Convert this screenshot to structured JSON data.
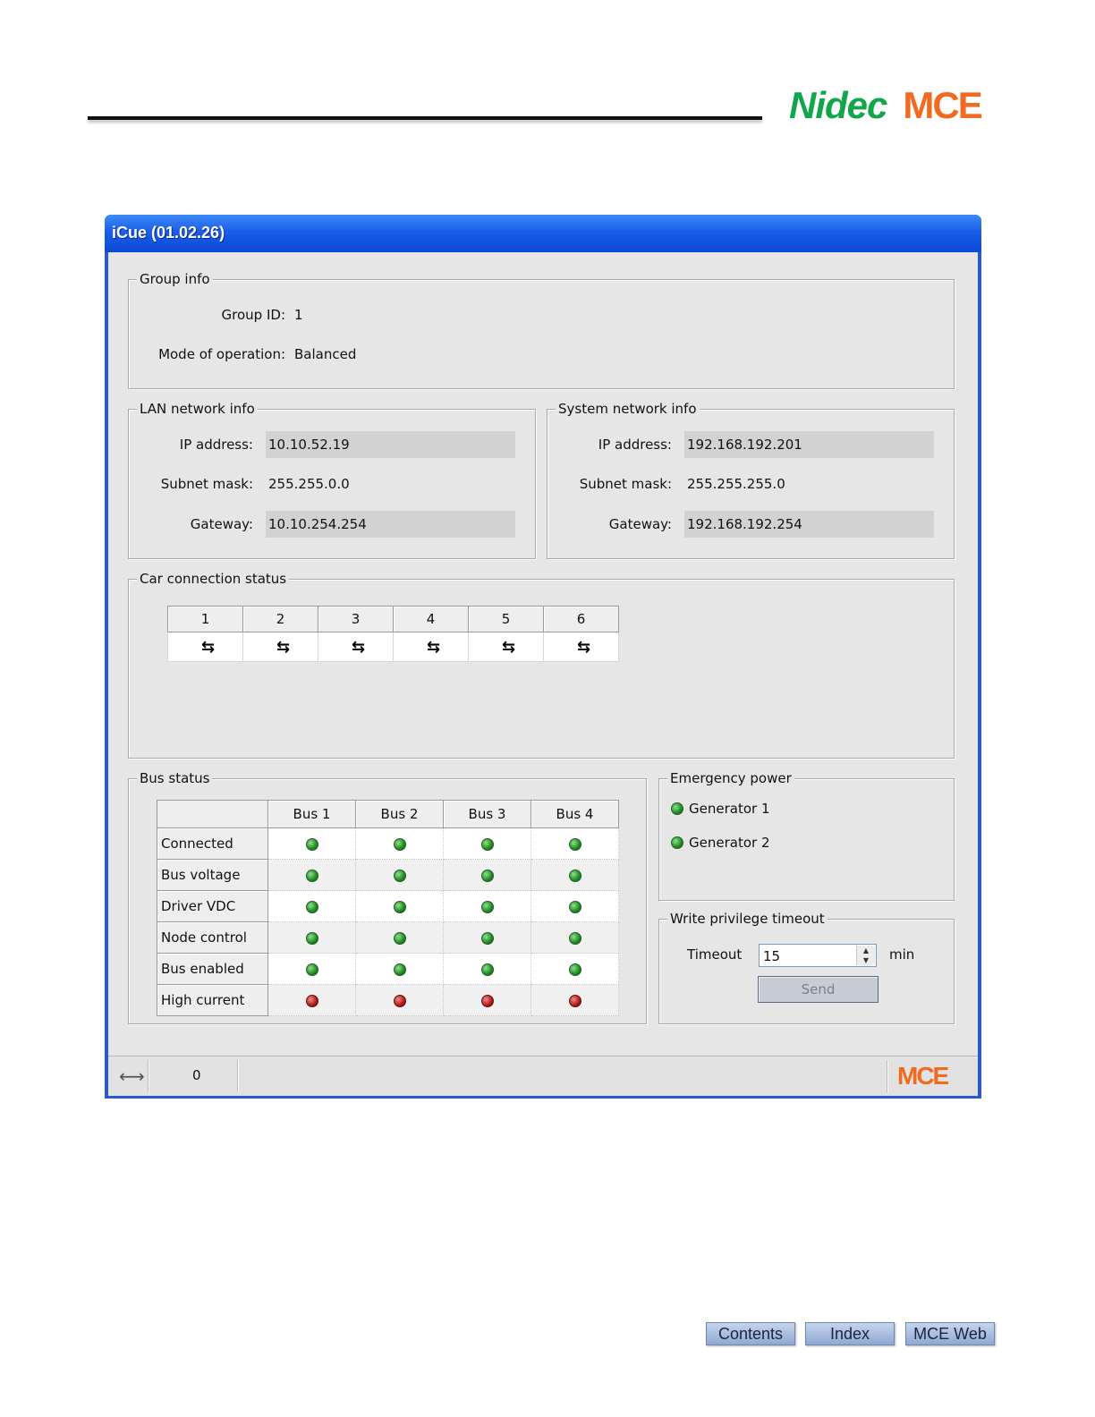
{
  "brand": {
    "company": "Nidec",
    "product": "MCE"
  },
  "window": {
    "title": "iCue (01.02.26)"
  },
  "group_info": {
    "legend": "Group info",
    "group_id_label": "Group ID:",
    "group_id": "1",
    "mode_label": "Mode of operation:",
    "mode": "Balanced"
  },
  "lan": {
    "legend": "LAN network info",
    "ip_label": "IP address:",
    "ip": "10.10.52.19",
    "subnet_label": "Subnet mask:",
    "subnet": "255.255.0.0",
    "gateway_label": "Gateway:",
    "gateway": "10.10.254.254"
  },
  "system": {
    "legend": "System network info",
    "ip_label": "IP address:",
    "ip": "192.168.192.201",
    "subnet_label": "Subnet mask:",
    "subnet": "255.255.255.0",
    "gateway_label": "Gateway:",
    "gateway": "192.168.192.254"
  },
  "cars": {
    "legend": "Car connection status",
    "ids": [
      "1",
      "2",
      "3",
      "4",
      "5",
      "6"
    ],
    "status_icon": "disconnected-arrows-icon"
  },
  "bus": {
    "legend": "Bus status",
    "columns": [
      "Bus 1",
      "Bus 2",
      "Bus 3",
      "Bus 4"
    ],
    "rows": [
      {
        "label": "Connected",
        "status": [
          "green",
          "green",
          "green",
          "green"
        ]
      },
      {
        "label": "Bus voltage",
        "status": [
          "green",
          "green",
          "green",
          "green"
        ]
      },
      {
        "label": "Driver VDC",
        "status": [
          "green",
          "green",
          "green",
          "green"
        ]
      },
      {
        "label": "Node control",
        "status": [
          "green",
          "green",
          "green",
          "green"
        ]
      },
      {
        "label": "Bus enabled",
        "status": [
          "green",
          "green",
          "green",
          "green"
        ]
      },
      {
        "label": "High current",
        "status": [
          "red",
          "red",
          "red",
          "red"
        ]
      }
    ]
  },
  "emergency": {
    "legend": "Emergency power",
    "generators": [
      {
        "label": "Generator 1",
        "status": "green"
      },
      {
        "label": "Generator 2",
        "status": "green"
      }
    ]
  },
  "write_privilege": {
    "legend": "Write privilege timeout",
    "timeout_label": "Timeout",
    "timeout_value": "15",
    "unit": "min",
    "send_label": "Send"
  },
  "statusbar": {
    "icon": "double-arrow-icon",
    "value": "0",
    "logo": "MCE"
  },
  "footer": {
    "contents": "Contents",
    "index": "Index",
    "web": "MCE Web"
  },
  "colors": {
    "green_led": "#1c8a1c",
    "red_led": "#b01818",
    "brand_green": "#12a64a",
    "brand_orange": "#f26a21",
    "title_blue": "#1a5de6"
  }
}
